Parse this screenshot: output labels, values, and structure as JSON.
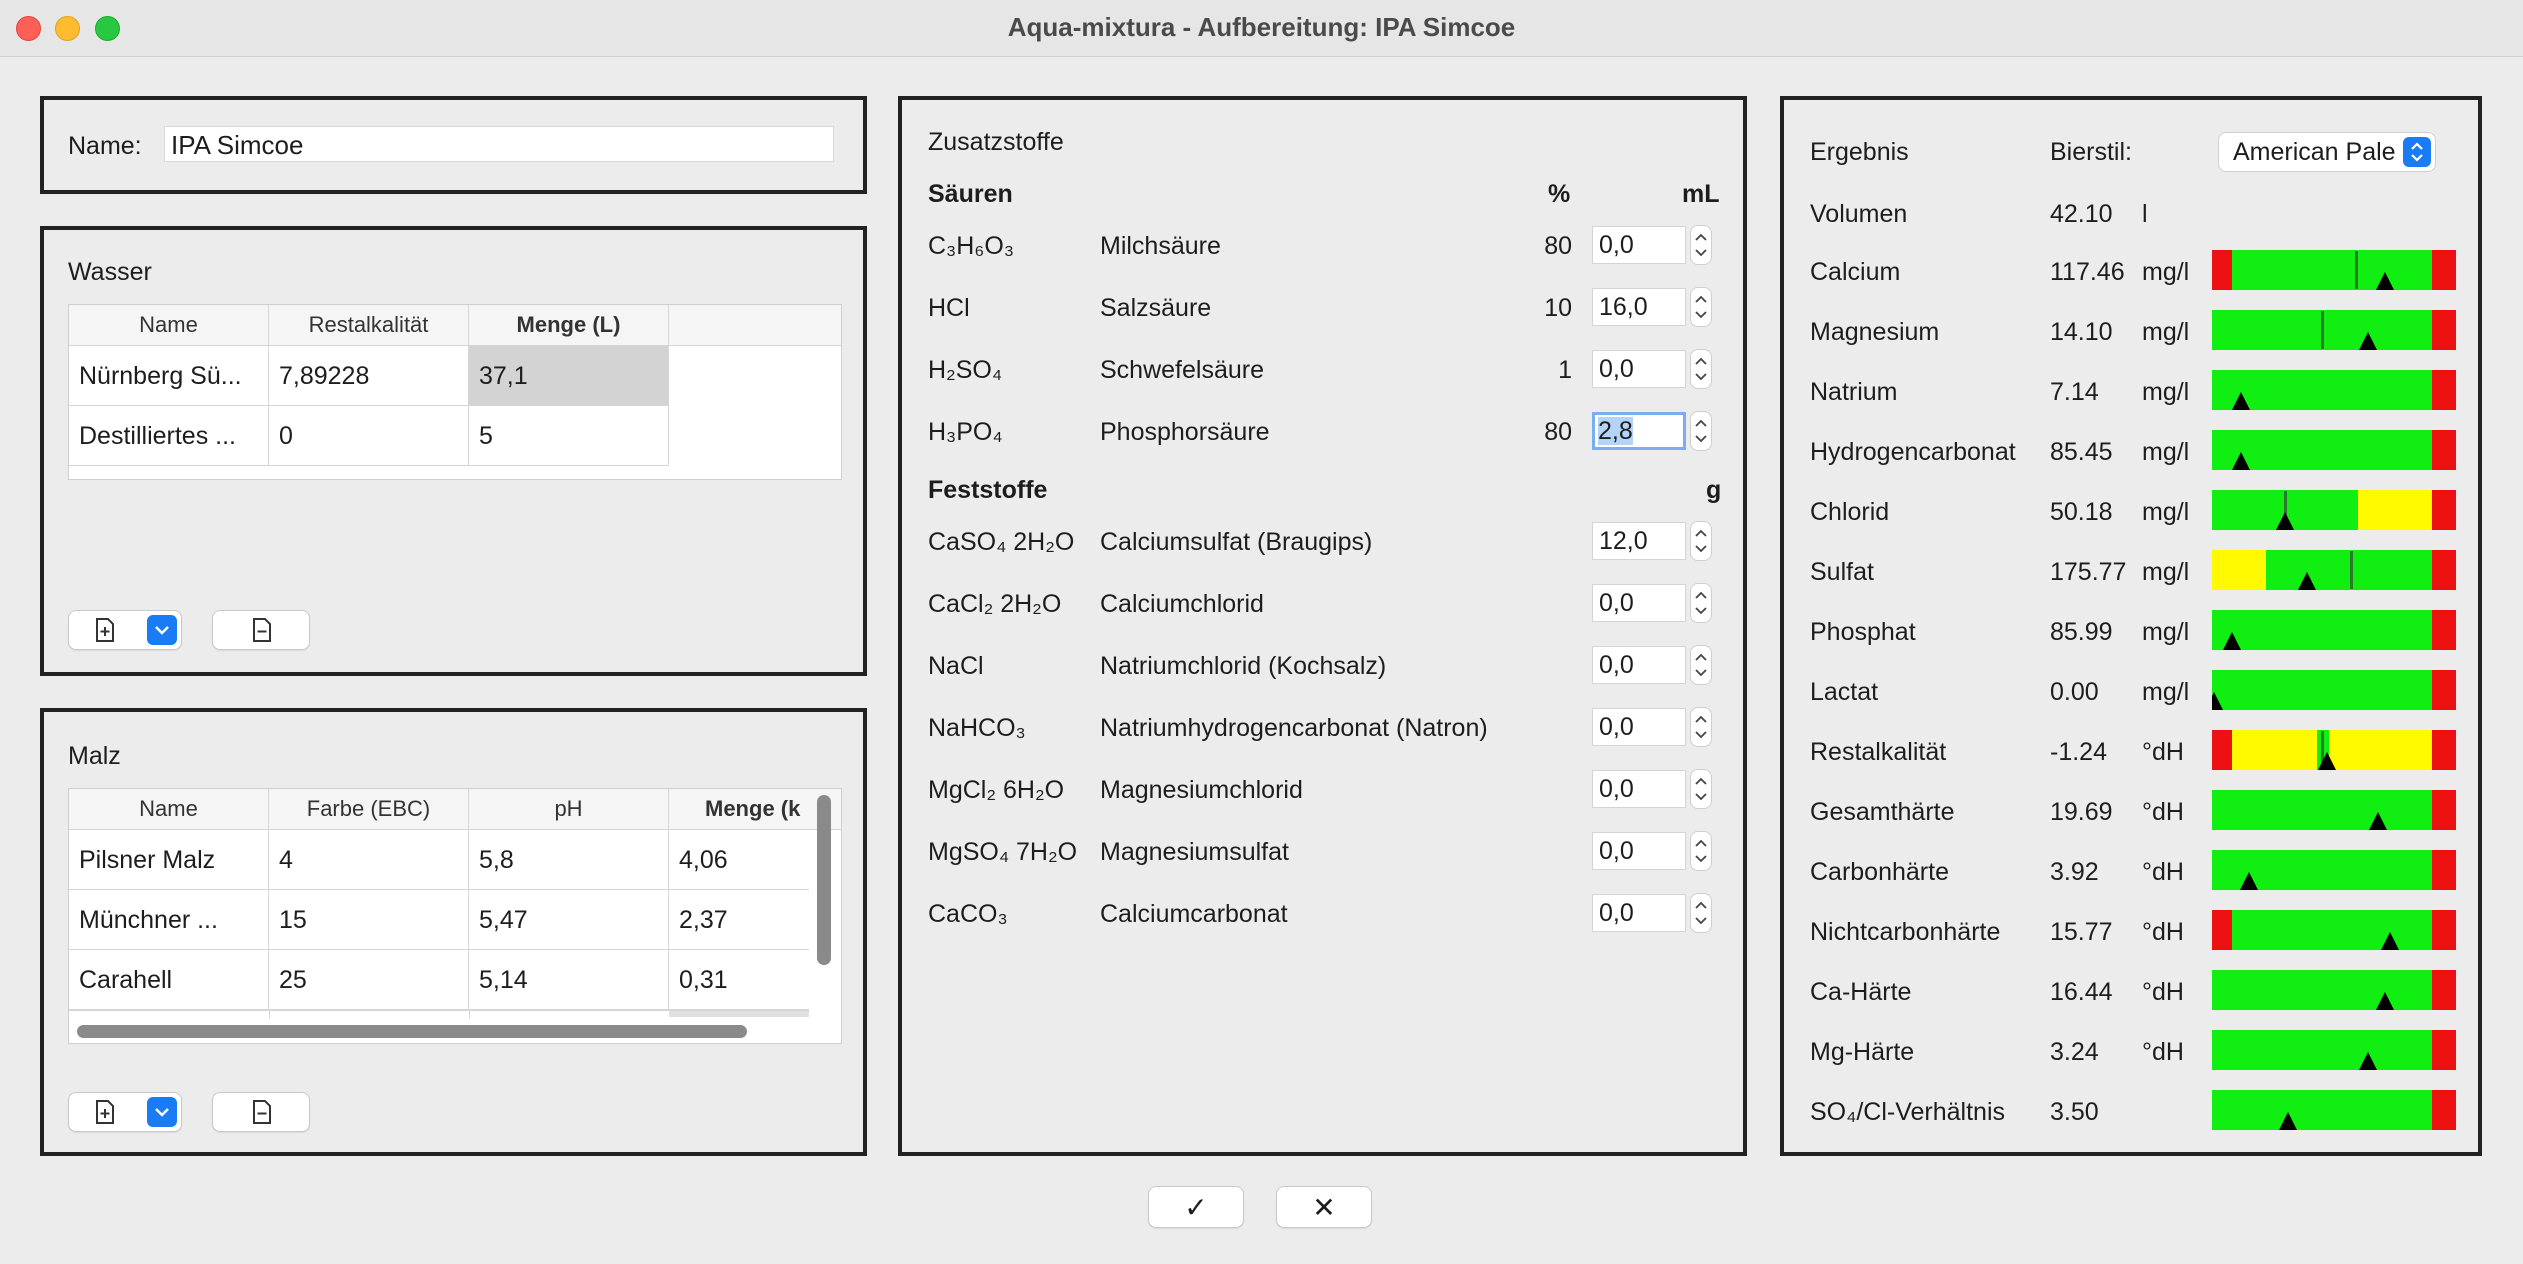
{
  "window": {
    "title": "Aqua-mixtura - Aufbereitung: IPA Simcoe"
  },
  "name": {
    "label": "Name:",
    "value": "IPA Simcoe"
  },
  "wasser": {
    "title": "Wasser",
    "columns": [
      "Name",
      "Restalkalität",
      "Menge (L)"
    ],
    "rows": [
      [
        "Nürnberg Sü...",
        "7,89228",
        "37,1"
      ],
      [
        "Destilliertes ...",
        "0",
        "5"
      ]
    ]
  },
  "malz": {
    "title": "Malz",
    "columns": [
      "Name",
      "Farbe (EBC)",
      "pH",
      "Menge (k"
    ],
    "rows": [
      [
        "Pilsner Malz",
        "4",
        "5,8",
        "4,06"
      ],
      [
        "Münchner ...",
        "15",
        "5,47",
        "2,37"
      ],
      [
        "Carahell",
        "25",
        "5,14",
        "0,31"
      ]
    ]
  },
  "zusatz": {
    "title": "Zusatzstoffe",
    "saeuren_header": "Säuren",
    "col_percent": "%",
    "col_ml": "mL",
    "saeuren": [
      {
        "formula": "C₃H₆O₃",
        "name": "Milchsäure",
        "percent": "80",
        "value": "0,0"
      },
      {
        "formula": "HCl",
        "name": "Salzsäure",
        "percent": "10",
        "value": "16,0"
      },
      {
        "formula": "H₂SO₄",
        "name": "Schwefelsäure",
        "percent": "1",
        "value": "0,0"
      },
      {
        "formula": "H₃PO₄",
        "name": "Phosphorsäure",
        "percent": "80",
        "value": "2,8"
      }
    ],
    "feststoffe_header": "Feststoffe",
    "col_g": "g",
    "feststoffe": [
      {
        "formula": "CaSO₄ 2H₂O",
        "name": "Calciumsulfat (Braugips)",
        "value": "12,0"
      },
      {
        "formula": "CaCl₂ 2H₂O",
        "name": "Calciumchlorid",
        "value": "0,0"
      },
      {
        "formula": "NaCl",
        "name": "Natriumchlorid (Kochsalz)",
        "value": "0,0"
      },
      {
        "formula": "NaHCO₃",
        "name": "Natriumhydrogencarbonat (Natron)",
        "value": "0,0"
      },
      {
        "formula": "MgCl₂ 6H₂O",
        "name": "Magnesiumchlorid",
        "value": "0,0"
      },
      {
        "formula": "MgSO₄ 7H₂O",
        "name": "Magnesiumsulfat",
        "value": "0,0"
      },
      {
        "formula": "CaCO₃",
        "name": "Calciumcarbonat",
        "value": "0,0"
      }
    ]
  },
  "ergebnis": {
    "title": "Ergebnis",
    "bierstil_label": "Bierstil:",
    "bierstil_value": "American Pale",
    "volumen": {
      "label": "Volumen",
      "value": "42.10",
      "unit": "l"
    },
    "rows": [
      {
        "label": "Calcium",
        "value": "117.46",
        "unit": "mg/l",
        "zones": [
          [
            "red",
            0,
            8
          ],
          [
            "green",
            8,
            90
          ],
          [
            "red",
            90,
            100
          ]
        ],
        "target": 59,
        "pointer": 71
      },
      {
        "label": "Magnesium",
        "value": "14.10",
        "unit": "mg/l",
        "zones": [
          [
            "green",
            0,
            90
          ],
          [
            "red",
            90,
            100
          ]
        ],
        "target": 45,
        "pointer": 64
      },
      {
        "label": "Natrium",
        "value": "7.14",
        "unit": "mg/l",
        "zones": [
          [
            "green",
            0,
            90
          ],
          [
            "red",
            90,
            100
          ]
        ],
        "target": null,
        "pointer": 12
      },
      {
        "label": "Hydrogencarbonat",
        "value": "85.45",
        "unit": "mg/l",
        "zones": [
          [
            "green",
            0,
            90
          ],
          [
            "red",
            90,
            100
          ]
        ],
        "target": null,
        "pointer": 12
      },
      {
        "label": "Chlorid",
        "value": "50.18",
        "unit": "mg/l",
        "zones": [
          [
            "green",
            0,
            60
          ],
          [
            "yellow",
            60,
            90
          ],
          [
            "red",
            90,
            100
          ]
        ],
        "target": 30,
        "pointer": 30
      },
      {
        "label": "Sulfat",
        "value": "175.77",
        "unit": "mg/l",
        "zones": [
          [
            "yellow",
            0,
            22
          ],
          [
            "green",
            22,
            90
          ],
          [
            "red",
            90,
            100
          ]
        ],
        "target": 57,
        "pointer": 39
      },
      {
        "label": "Phosphat",
        "value": "85.99",
        "unit": "mg/l",
        "zones": [
          [
            "green",
            0,
            90
          ],
          [
            "red",
            90,
            100
          ]
        ],
        "target": null,
        "pointer": 8
      },
      {
        "label": "Lactat",
        "value": "0.00",
        "unit": "mg/l",
        "zones": [
          [
            "green",
            0,
            90
          ],
          [
            "red",
            90,
            100
          ]
        ],
        "target": null,
        "pointer": 1
      },
      {
        "label": "Restalkalität",
        "value": "-1.24",
        "unit": "°dH",
        "zones": [
          [
            "red",
            0,
            8
          ],
          [
            "yellow",
            8,
            43
          ],
          [
            "green",
            43,
            48
          ],
          [
            "yellow",
            48,
            90
          ],
          [
            "red",
            90,
            100
          ]
        ],
        "target": 45,
        "pointer": 47
      },
      {
        "label": "Gesamthärte",
        "value": "19.69",
        "unit": "°dH",
        "zones": [
          [
            "green",
            0,
            90
          ],
          [
            "red",
            90,
            100
          ]
        ],
        "target": null,
        "pointer": 68
      },
      {
        "label": "Carbonhärte",
        "value": "3.92",
        "unit": "°dH",
        "zones": [
          [
            "green",
            0,
            90
          ],
          [
            "red",
            90,
            100
          ]
        ],
        "target": null,
        "pointer": 15
      },
      {
        "label": "Nichtcarbonhärte",
        "value": "15.77",
        "unit": "°dH",
        "zones": [
          [
            "red",
            0,
            8
          ],
          [
            "green",
            8,
            90
          ],
          [
            "red",
            90,
            100
          ]
        ],
        "target": null,
        "pointer": 73
      },
      {
        "label": "Ca-Härte",
        "value": "16.44",
        "unit": "°dH",
        "zones": [
          [
            "green",
            0,
            90
          ],
          [
            "red",
            90,
            100
          ]
        ],
        "target": null,
        "pointer": 71
      },
      {
        "label": "Mg-Härte",
        "value": "3.24",
        "unit": "°dH",
        "zones": [
          [
            "green",
            0,
            90
          ],
          [
            "red",
            90,
            100
          ]
        ],
        "target": null,
        "pointer": 64
      },
      {
        "label": "SO₄/Cl-Verhältnis",
        "value": "3.50",
        "unit": "",
        "zones": [
          [
            "green",
            0,
            90
          ],
          [
            "red",
            90,
            100
          ]
        ],
        "target": null,
        "pointer": 31
      }
    ]
  },
  "colors": {
    "red": "#ee1111",
    "green": "#11ee11",
    "yellow": "#fffa00",
    "accent": "#1a7cf5"
  },
  "icons": {
    "ok": "✓",
    "cancel": "✕",
    "add": "add-file-icon",
    "remove": "remove-file-icon"
  }
}
